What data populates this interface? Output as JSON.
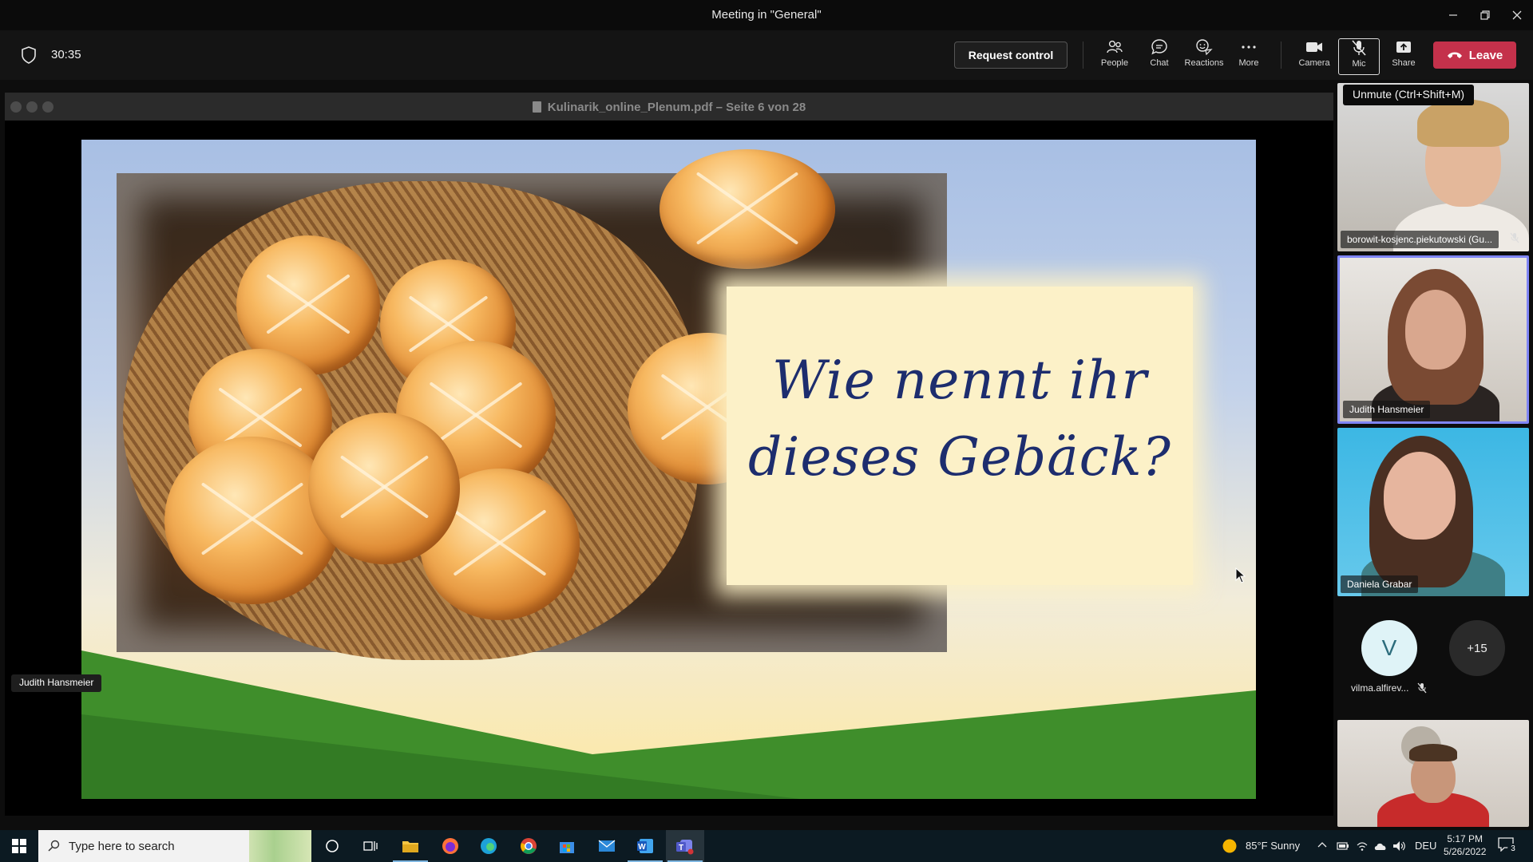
{
  "window": {
    "title": "Meeting in \"General\""
  },
  "toolbar": {
    "timer": "30:35",
    "request_control": "Request control",
    "people": "People",
    "chat": "Chat",
    "reactions": "Reactions",
    "more": "More",
    "camera": "Camera",
    "mic": "Mic",
    "share": "Share",
    "leave": "Leave"
  },
  "tooltip": "Unmute (Ctrl+Shift+M)",
  "shared_window": {
    "title": "Kulinarik_online_Plenum.pdf – Seite 6 von 28",
    "slide_line1": "Wie nennt ihr",
    "slide_line2": "dieses Gebäck?",
    "presenter": "Judith Hansmeier"
  },
  "participants": [
    {
      "name": "borowit-kosjenc.piekutowski (Gu...",
      "muted": true
    },
    {
      "name": "Judith Hansmeier",
      "active": true
    },
    {
      "name": "Daniela Grabar"
    }
  ],
  "avatars": {
    "initial": "V",
    "name": "vilma.alfirev...",
    "more": "+15"
  },
  "taskbar": {
    "search_placeholder": "Type here to search",
    "weather": "85°F  Sunny",
    "language": "DEU",
    "time": "5:17 PM",
    "date": "5/26/2022",
    "notifications": "3"
  },
  "colors": {
    "leave": "#c4314b",
    "active_speaker": "#7f85f5",
    "slide_text": "#1d2d6e"
  }
}
